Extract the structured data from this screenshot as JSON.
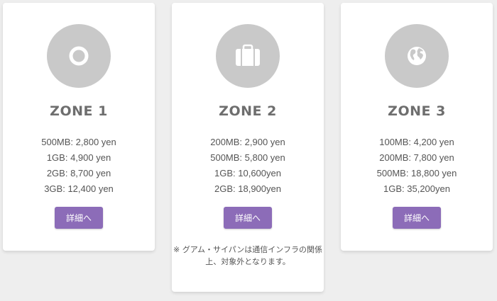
{
  "colors": {
    "page_bg": "#eeeeee",
    "card_bg": "#ffffff",
    "icon_bg": "#c9c9c9",
    "button_bg": "#8c6cb8",
    "title_text": "#6e6e6e"
  },
  "zones": [
    {
      "icon": "ring-icon",
      "title": "ZONE 1",
      "plans": [
        "500MB: 2,800 yen",
        "1GB: 4,900 yen",
        "2GB: 8,700 yen",
        "3GB: 12,400 yen"
      ],
      "button_label": "詳細へ"
    },
    {
      "icon": "suitcase-icon",
      "title": "ZONE 2",
      "plans": [
        "200MB: 2,900 yen",
        "500MB: 5,800 yen",
        "1GB: 10,600yen",
        "2GB: 18,900yen"
      ],
      "button_label": "詳細へ",
      "note_line1": "※ グアム・サイパンは通信インフラの関係",
      "note_line2": "上、対象外となります。"
    },
    {
      "icon": "globe-icon",
      "title": "ZONE 3",
      "plans": [
        "100MB: 4,200 yen",
        "200MB: 7,800 yen",
        "500MB: 18,800 yen",
        "1GB: 35,200yen"
      ],
      "button_label": "詳細へ"
    }
  ]
}
